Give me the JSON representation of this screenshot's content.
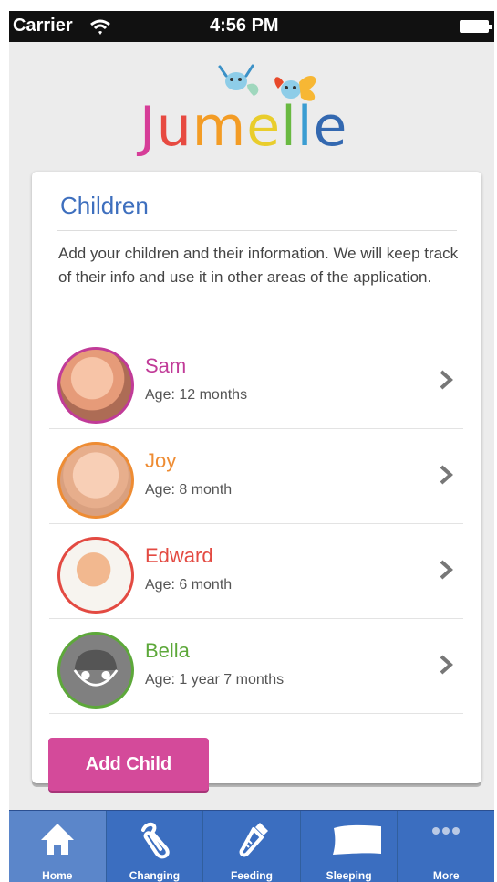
{
  "status_bar": {
    "carrier": "Carrier",
    "time": "4:56 PM"
  },
  "brand": {
    "logo_letters": [
      "J",
      "u",
      "m",
      "e",
      "l",
      "l",
      "e"
    ]
  },
  "children_card": {
    "title": "Children",
    "description": "Add your children and their information. We will keep track of their info and use it in other areas of the application."
  },
  "children": [
    {
      "name": "Sam",
      "age": "Age: 12 months",
      "color": "#c13b98"
    },
    {
      "name": "Joy",
      "age": "Age: 8 month",
      "color": "#ee8c33"
    },
    {
      "name": "Edward",
      "age": "Age: 6 month",
      "color": "#e34a42"
    },
    {
      "name": "Bella",
      "age": "Age: 1 year 7 months",
      "color": "#5da83a"
    }
  ],
  "actions": {
    "add_child": "Add Child"
  },
  "tab_bar": {
    "tabs": [
      {
        "label": "Home",
        "icon": "home-icon",
        "active": true
      },
      {
        "label": "Changing",
        "icon": "safety-pin-icon",
        "active": false
      },
      {
        "label": "Feeding",
        "icon": "baby-bottle-icon",
        "active": false
      },
      {
        "label": "Sleeping",
        "icon": "pillow-icon",
        "active": false
      },
      {
        "label": "More",
        "icon": "more-icon",
        "active": false
      }
    ]
  },
  "colors": {
    "accent": "#d44a9a",
    "title": "#3e6fbe",
    "tab_bar": "#3b6ec0"
  }
}
